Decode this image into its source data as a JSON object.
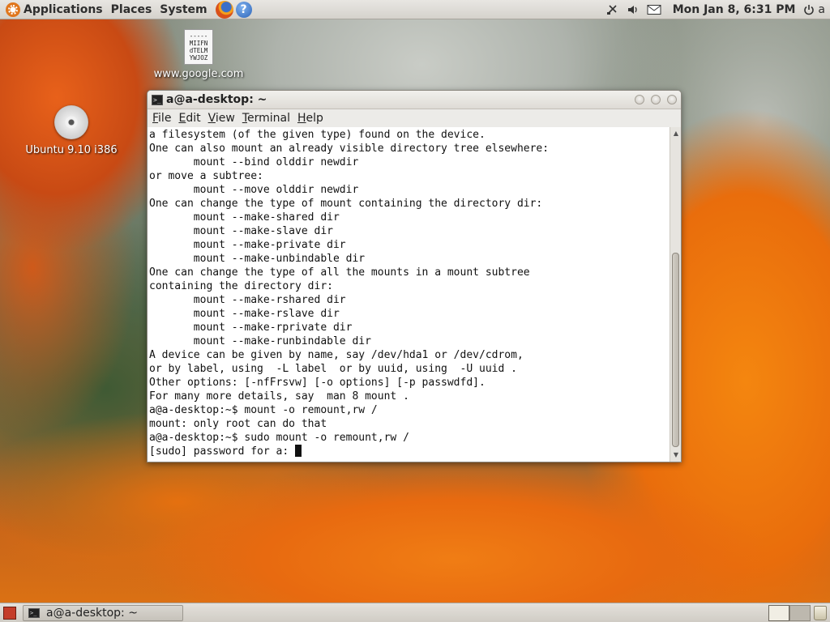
{
  "top_panel": {
    "menus": [
      "Applications",
      "Places",
      "System"
    ],
    "help_glyph": "?",
    "clock": "Mon Jan  8,  6:31 PM",
    "user": "a",
    "tray_icons": [
      "network-icon",
      "volume-icon",
      "mail-icon",
      "power-icon"
    ]
  },
  "desktop": {
    "file_icon": {
      "label": "www.google.com",
      "preview_lines": [
        "-----",
        "MIIFN",
        "dTELM",
        "YWJOZ"
      ]
    },
    "cd_icon": {
      "label": "Ubuntu 9.10 i386"
    }
  },
  "terminal": {
    "title": "a@a-desktop: ~",
    "menu": [
      {
        "underline": "F",
        "rest": "ile"
      },
      {
        "underline": "E",
        "rest": "dit"
      },
      {
        "underline": "V",
        "rest": "iew"
      },
      {
        "underline": "T",
        "rest": "erminal"
      },
      {
        "underline": "H",
        "rest": "elp"
      }
    ],
    "lines": [
      "a filesystem (of the given type) found on the device.",
      "One can also mount an already visible directory tree elsewhere:",
      "       mount --bind olddir newdir",
      "or move a subtree:",
      "       mount --move olddir newdir",
      "One can change the type of mount containing the directory dir:",
      "       mount --make-shared dir",
      "       mount --make-slave dir",
      "       mount --make-private dir",
      "       mount --make-unbindable dir",
      "One can change the type of all the mounts in a mount subtree",
      "containing the directory dir:",
      "       mount --make-rshared dir",
      "       mount --make-rslave dir",
      "       mount --make-rprivate dir",
      "       mount --make-runbindable dir",
      "A device can be given by name, say /dev/hda1 or /dev/cdrom,",
      "or by label, using  -L label  or by uuid, using  -U uuid .",
      "Other options: [-nfFrsvw] [-o options] [-p passwdfd].",
      "For many more details, say  man 8 mount .",
      "a@a-desktop:~$ mount -o remount,rw /",
      "mount: only root can do that",
      "a@a-desktop:~$ sudo mount -o remount,rw /"
    ],
    "prompt_line": "[sudo] password for a: "
  },
  "bottom_panel": {
    "task_label": "a@a-desktop: ~"
  }
}
